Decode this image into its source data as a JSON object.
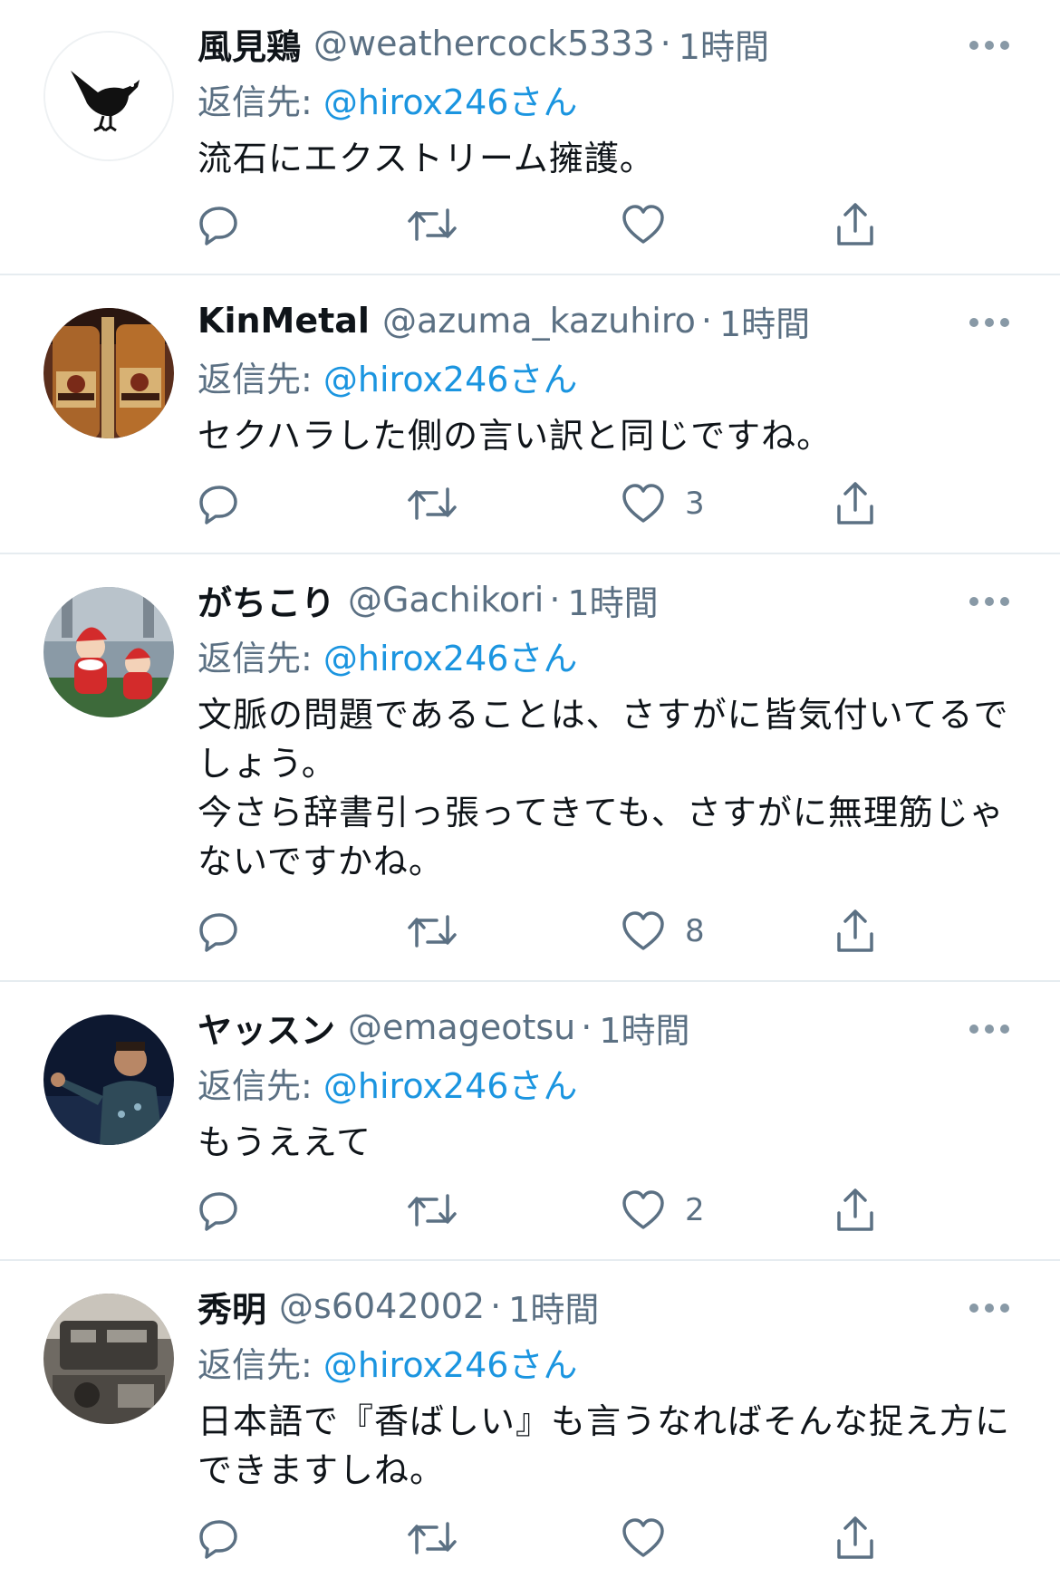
{
  "theme": {
    "accent": "#1b95e0",
    "text": "#0f1419",
    "muted": "#5b7083",
    "divider": "#e6ecf0"
  },
  "reply_prefix": "返信先: ",
  "tweets": [
    {
      "name": "風見鶏",
      "handle": "@weathercock5333",
      "time": "1時間",
      "reply_mention": "@hirox246さん",
      "text_lines": [
        "流石にエクストリーム擁護。"
      ],
      "like_count": "",
      "avatar": "bird-avatar"
    },
    {
      "name": "KinMetal",
      "handle": "@azuma_kazuhiro",
      "time": "1時間",
      "reply_mention": "@hirox246さん",
      "text_lines": [
        "セクハラした側の言い訳と同じですね。"
      ],
      "like_count": "3",
      "avatar": "beer-bottles-avatar"
    },
    {
      "name": "がちこり",
      "handle": "@Gachikori",
      "time": "1時間",
      "reply_mention": "@hirox246さん",
      "text_lines": [
        "文脈の問題であることは、さすがに皆気付いてるで",
        "しょう。",
        "今さら辞書引っ張ってきても、さすがに無理筋じゃ",
        "ないですかね。"
      ],
      "like_count": "8",
      "avatar": "santa-avatar"
    },
    {
      "name": "ヤッスン",
      "handle": "@emageotsu",
      "time": "1時間",
      "reply_mention": "@hirox246さん",
      "text_lines": [
        "もうええて"
      ],
      "like_count": "2",
      "avatar": "athlete-avatar"
    },
    {
      "name": "秀明",
      "handle": "@s6042002",
      "time": "1時間",
      "reply_mention": "@hirox246さん",
      "text_lines": [
        "日本語で『香ばしい』も言うなればそんな捉え方に",
        "できますしね。"
      ],
      "like_count": "",
      "avatar": "machine-avatar"
    }
  ]
}
